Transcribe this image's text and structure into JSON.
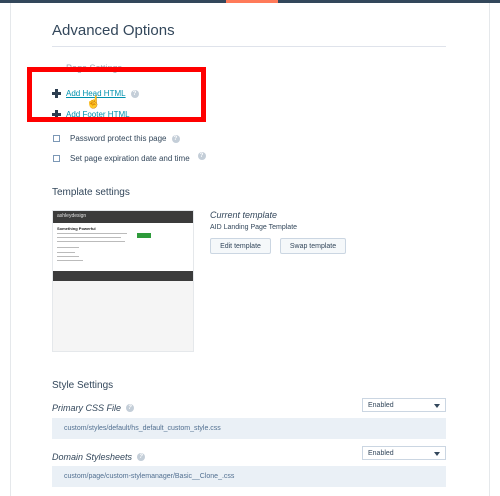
{
  "page": {
    "title": "Advanced Options"
  },
  "page_settings": {
    "section_label": "Page Settings",
    "add_head_html_label": "Add Head HTML",
    "add_footer_html_label": "Add Footer HTML",
    "password_protect_label": "Password protect this page",
    "expiration_label": "Set page expiration date and time",
    "help_glyph": "?"
  },
  "template_settings": {
    "heading": "Template settings",
    "thumbnail_logo": "ashleydesign",
    "thumbnail_heading": "Something Powerful",
    "current_label": "Current template",
    "current_name": "AID Landing Page Template",
    "edit_button": "Edit template",
    "swap_button": "Swap template"
  },
  "style_settings": {
    "heading": "Style Settings",
    "primary_css": {
      "label": "Primary CSS File",
      "select_value": "Enabled",
      "path": "custom/styles/default/hs_default_custom_style.css"
    },
    "domain_stylesheets": {
      "label": "Domain Stylesheets",
      "select_value": "Enabled",
      "path": "custom/page/custom-stylemanager/Basic__Clone_.css"
    }
  },
  "colors": {
    "accent": "#ff7a59",
    "highlight": "#ff0000",
    "link": "#0091ae",
    "text": "#33475b"
  },
  "icons": [
    "plus-icon",
    "help-icon",
    "hand-cursor-icon",
    "chevron-down-icon"
  ]
}
